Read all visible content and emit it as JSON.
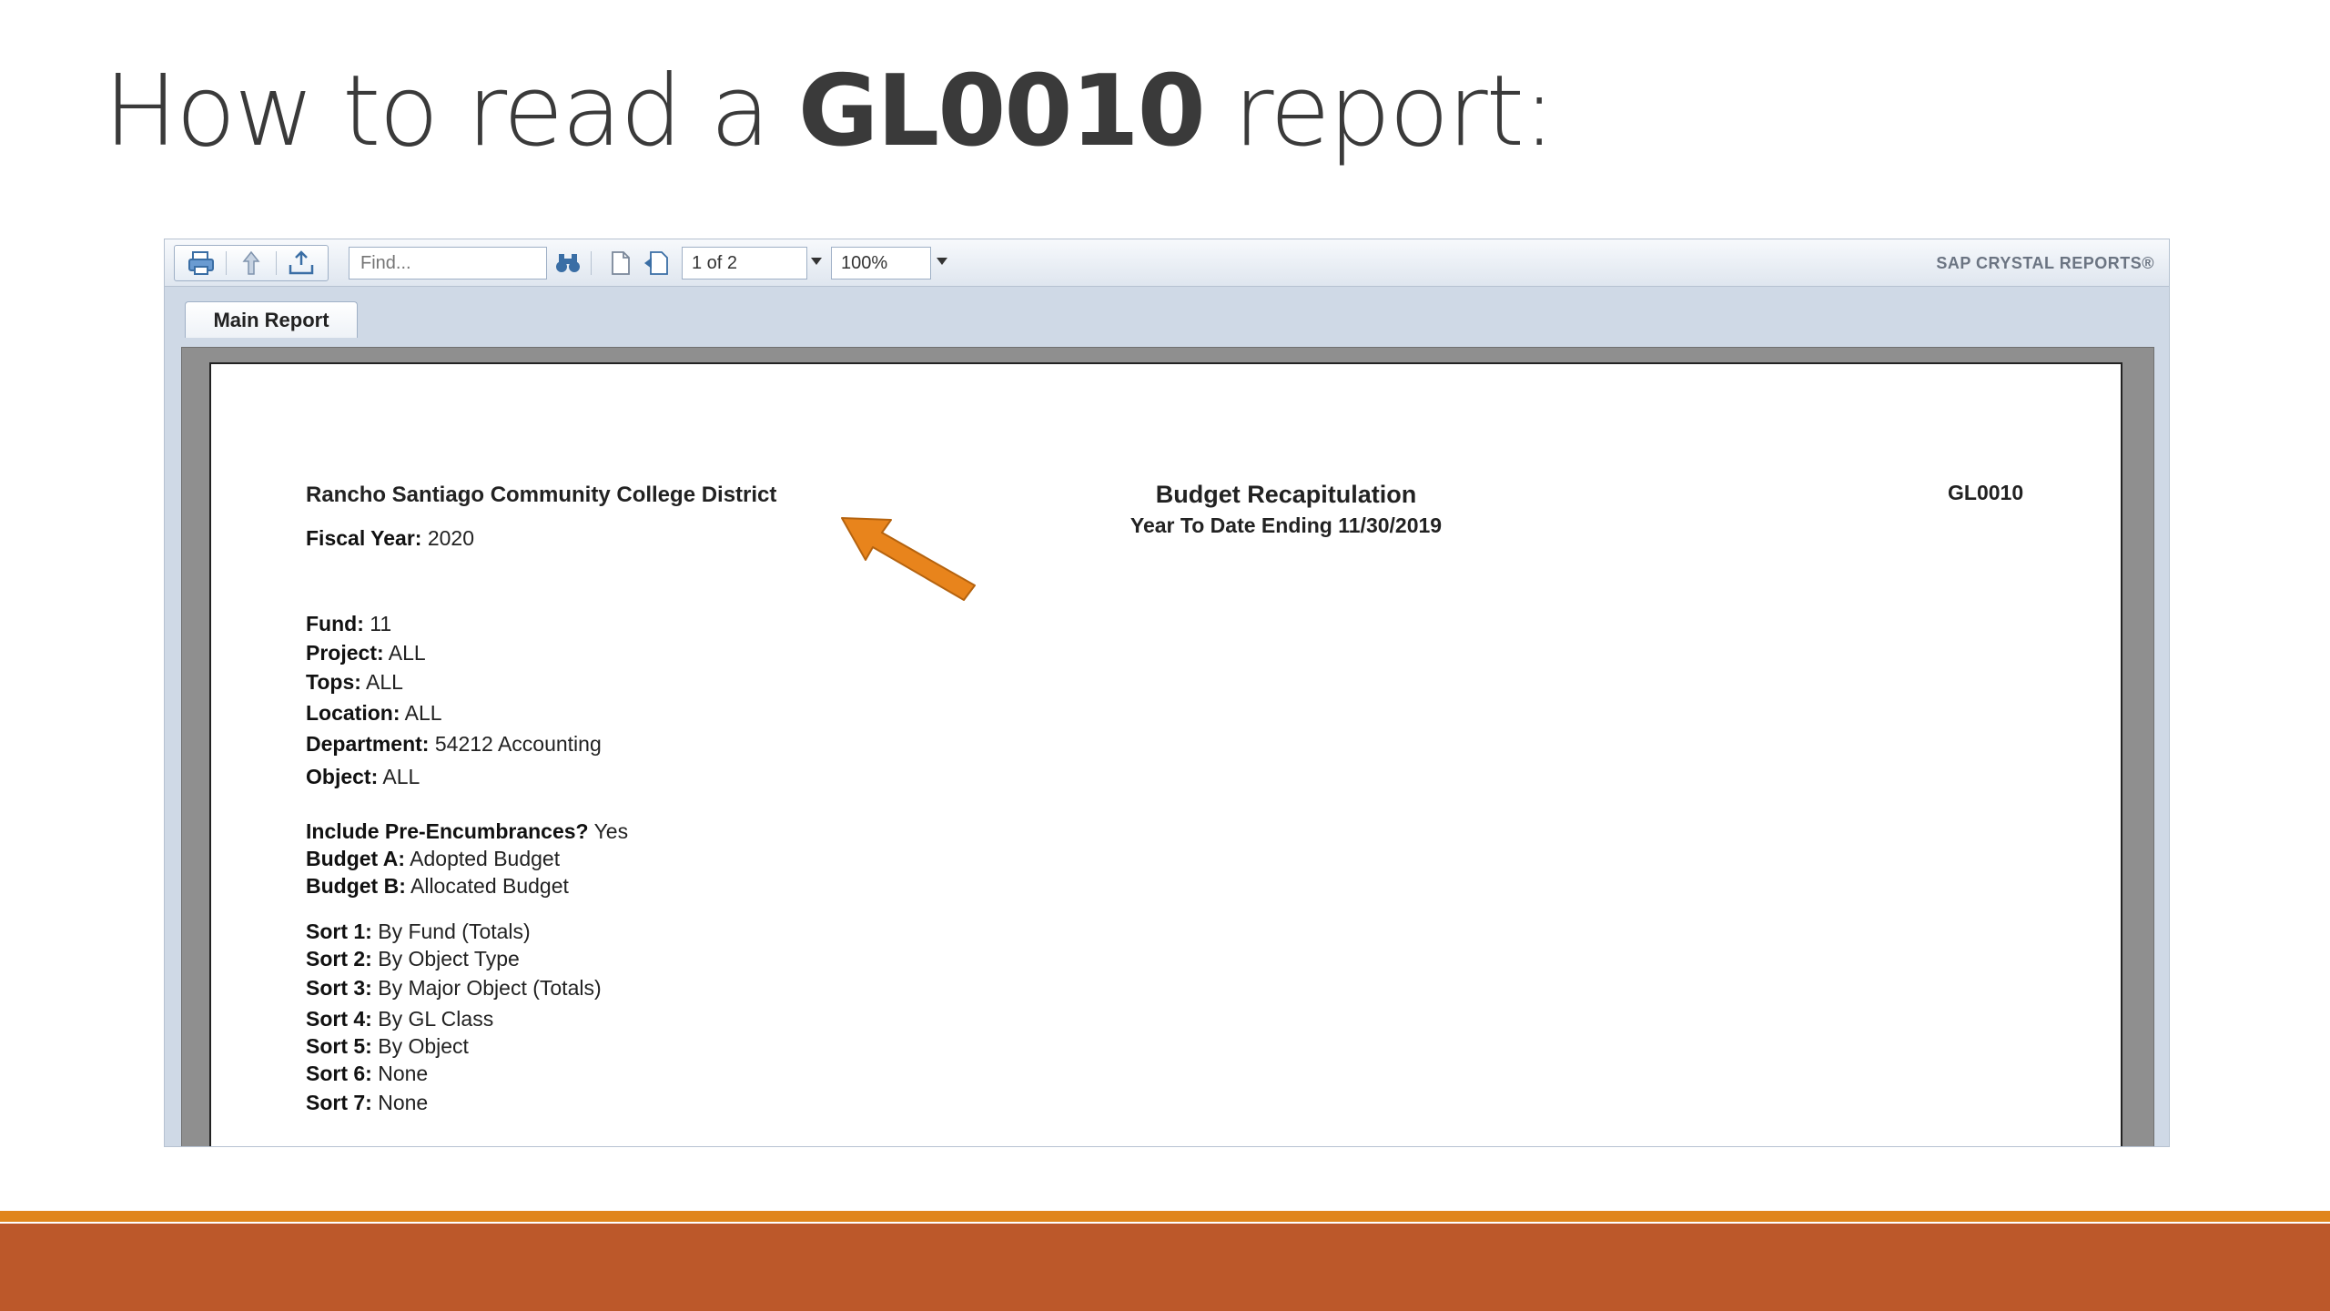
{
  "slide": {
    "title_pre": "How to read a ",
    "title_bold": "GL0010",
    "title_post": " report:"
  },
  "viewer": {
    "find_placeholder": "Find...",
    "page_value": "1 of 2",
    "zoom_value": "100%",
    "brand": "SAP CRYSTAL REPORTS®",
    "tab_label": "Main Report"
  },
  "report": {
    "org": "Rancho Santiago Community College District",
    "fiscal_label": "Fiscal Year:",
    "fiscal_value": "2020",
    "title": "Budget Recapitulation",
    "subtitle": "Year To Date Ending 11/30/2019",
    "report_code": "GL0010",
    "params": [
      {
        "label": "Fund:",
        "value": "11"
      },
      {
        "label": "Project:",
        "value": "ALL"
      },
      {
        "label": "Tops:",
        "value": "ALL"
      },
      {
        "label": "Location:",
        "value": "ALL"
      },
      {
        "label": "Department:",
        "value": "54212 Accounting"
      },
      {
        "label": "Object:",
        "value": "ALL"
      },
      {
        "label": "Include Pre-Encumbrances?",
        "value": "Yes"
      },
      {
        "label": "Budget A:",
        "value": "Adopted Budget"
      },
      {
        "label": "Budget B:",
        "value": "Allocated Budget"
      },
      {
        "label": "Sort 1:",
        "value": "By Fund (Totals)"
      },
      {
        "label": "Sort 2:",
        "value": "By Object Type"
      },
      {
        "label": "Sort 3:",
        "value": "By Major Object (Totals)"
      },
      {
        "label": "Sort 4:",
        "value": "By GL Class"
      },
      {
        "label": "Sort 5:",
        "value": "By Object"
      },
      {
        "label": "Sort 6:",
        "value": "None"
      },
      {
        "label": "Sort 7:",
        "value": "None"
      }
    ]
  },
  "colors": {
    "accent_orange": "#e0851c",
    "footer_rust": "#bc582a",
    "arrow_orange": "#e8841c"
  },
  "icons": [
    "print-icon",
    "export-icon",
    "upload-icon",
    "binoculars-icon",
    "page-icon",
    "next-page-icon",
    "arrow-callout-icon"
  ]
}
